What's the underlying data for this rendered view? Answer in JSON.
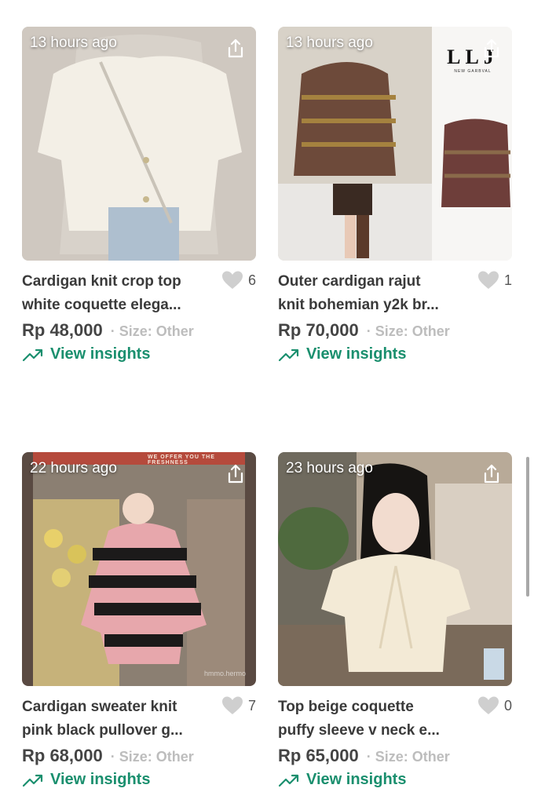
{
  "listings": [
    {
      "time": "13 hours ago",
      "title1": "Cardigan knit crop top",
      "title2": "white coquette elega...",
      "likes": "6",
      "price": "Rp 48,000",
      "size": "· Size: Other",
      "insights": "View insights"
    },
    {
      "time": "13 hours ago",
      "title1": "Outer cardigan rajut",
      "title2": "knit bohemian y2k br...",
      "likes": "1",
      "price": "Rp 70,000",
      "size": "· Size: Other",
      "insights": "View insights",
      "logo_text": "LLJ",
      "logo_sub": "NEW GARBVAL"
    },
    {
      "time": "22 hours ago",
      "title1": "Cardigan sweater knit",
      "title2": "pink black pullover g...",
      "likes": "7",
      "price": "Rp 68,000",
      "size": "· Size: Other",
      "insights": "View insights",
      "banner_text": "WE OFFER YOU THE FRESHNESS",
      "watermark": "hmmo.hermo"
    },
    {
      "time": "23 hours ago",
      "title1": "Top beige coquette",
      "title2": "puffy sleeve v neck e...",
      "likes": "0",
      "price": "Rp 65,000",
      "size": "· Size: Other",
      "insights": "View insights"
    }
  ],
  "colors": {
    "accent": "#1a8f6e",
    "heart": "#cfcfcf",
    "muted": "#bdbdbd"
  },
  "icons": [
    "share-icon",
    "heart-icon",
    "trending-up-icon"
  ]
}
